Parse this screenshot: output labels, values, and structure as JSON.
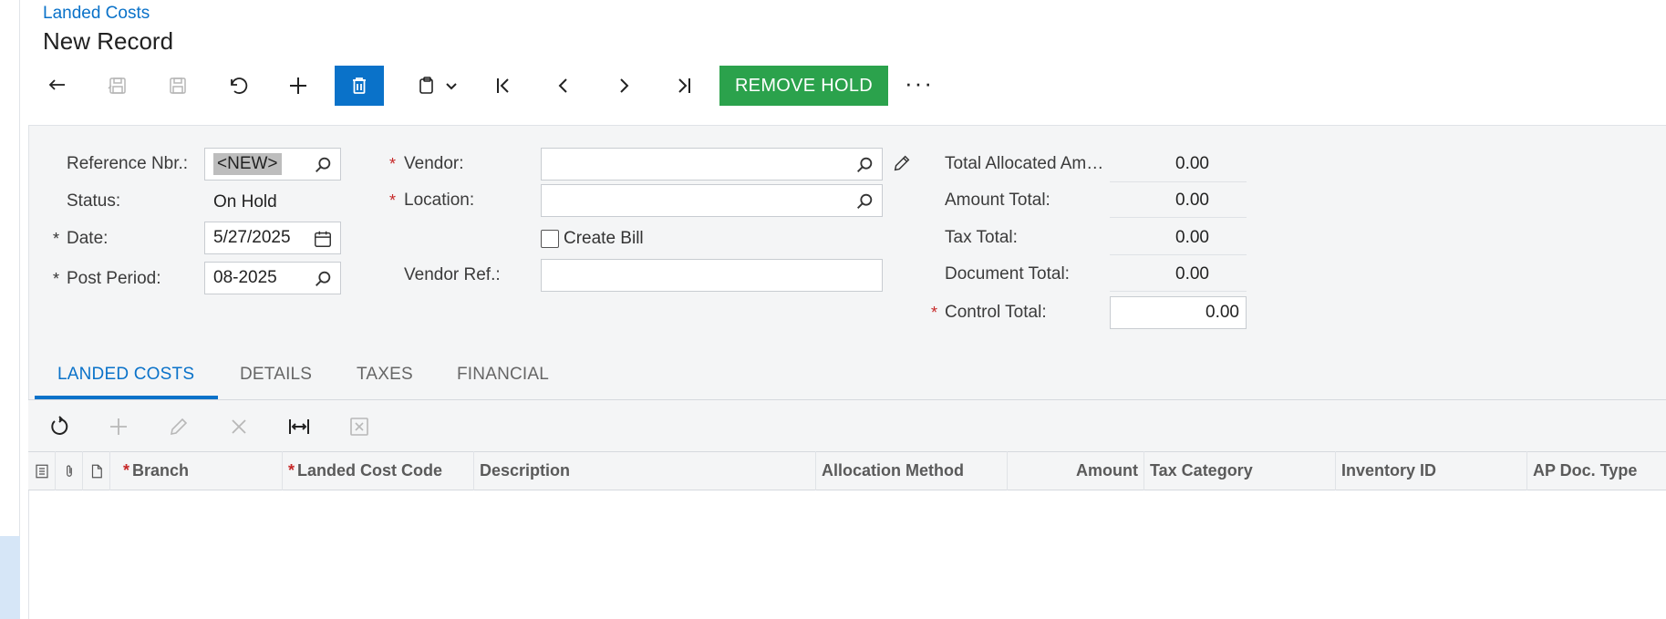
{
  "header": {
    "breadcrumb": "Landed Costs",
    "title": "New Record"
  },
  "toolbar": {
    "buttons": [
      {
        "name": "back",
        "icon": "undo-arrow-icon",
        "enabled": true
      },
      {
        "name": "save-and-close",
        "icon": "save-close-icon",
        "enabled": false
      },
      {
        "name": "save",
        "icon": "save-icon",
        "enabled": false
      },
      {
        "name": "cancel",
        "icon": "revert-icon",
        "enabled": true
      },
      {
        "name": "add",
        "icon": "plus-icon",
        "enabled": true
      },
      {
        "name": "delete",
        "icon": "trash-icon",
        "enabled": true
      },
      {
        "name": "copy-paste",
        "icon": "clipboard-icon",
        "enabled": true
      },
      {
        "name": "first",
        "icon": "first-record-icon",
        "enabled": true
      },
      {
        "name": "previous",
        "icon": "chevron-left-icon",
        "enabled": true
      },
      {
        "name": "next",
        "icon": "chevron-right-icon",
        "enabled": true
      },
      {
        "name": "last",
        "icon": "last-record-icon",
        "enabled": true
      }
    ],
    "remove_hold_label": "REMOVE HOLD",
    "more_label": "···"
  },
  "form": {
    "reference_nbr": {
      "label": "Reference Nbr.:",
      "value": "<NEW>"
    },
    "status": {
      "label": "Status:",
      "value": "On Hold"
    },
    "date": {
      "label": "Date:",
      "value": "5/27/2025",
      "required_mark": "*"
    },
    "post_period": {
      "label": "Post Period:",
      "value": "08-2025",
      "required_mark": "*"
    },
    "vendor": {
      "label": "Vendor:",
      "value": "",
      "required_mark": "*"
    },
    "location": {
      "label": "Location:",
      "value": "",
      "required_mark": "*"
    },
    "create_bill": {
      "label": "Create Bill",
      "checked": false
    },
    "vendor_ref": {
      "label": "Vendor Ref.:",
      "value": ""
    },
    "totals": {
      "total_allocated": {
        "label": "Total Allocated Am…",
        "value": "0.00"
      },
      "amount_total": {
        "label": "Amount Total:",
        "value": "0.00"
      },
      "tax_total": {
        "label": "Tax Total:",
        "value": "0.00"
      },
      "document_total": {
        "label": "Document Total:",
        "value": "0.00"
      },
      "control_total": {
        "label": "Control Total:",
        "value": "0.00",
        "required_mark": "*"
      }
    }
  },
  "tabs": [
    {
      "label": "LANDED COSTS",
      "active": true
    },
    {
      "label": "DETAILS",
      "active": false
    },
    {
      "label": "TAXES",
      "active": false
    },
    {
      "label": "FINANCIAL",
      "active": false
    }
  ],
  "grid": {
    "toolbar": [
      {
        "name": "refresh",
        "icon": "refresh-icon",
        "enabled": true
      },
      {
        "name": "add-row",
        "icon": "plus-icon",
        "enabled": false
      },
      {
        "name": "edit-row",
        "icon": "pencil-icon",
        "enabled": false
      },
      {
        "name": "delete-row",
        "icon": "close-icon",
        "enabled": false
      },
      {
        "name": "fit-columns",
        "icon": "fit-width-icon",
        "enabled": true
      },
      {
        "name": "export-excel",
        "icon": "excel-icon",
        "enabled": false
      }
    ],
    "columns": [
      {
        "label": "Branch",
        "required": true
      },
      {
        "label": "Landed Cost Code",
        "required": true
      },
      {
        "label": "Description",
        "required": false
      },
      {
        "label": "Allocation Method",
        "required": false
      },
      {
        "label": "Amount",
        "required": false,
        "align": "right"
      },
      {
        "label": "Tax Category",
        "required": false
      },
      {
        "label": "Inventory ID",
        "required": false
      },
      {
        "label": "AP Doc. Type",
        "required": false
      }
    ],
    "required_mark": "*",
    "rows": []
  },
  "colors": {
    "accent": "#0a72c9",
    "success": "#2ba24c",
    "required": "#c62828",
    "panel_bg": "#f4f5f6"
  }
}
